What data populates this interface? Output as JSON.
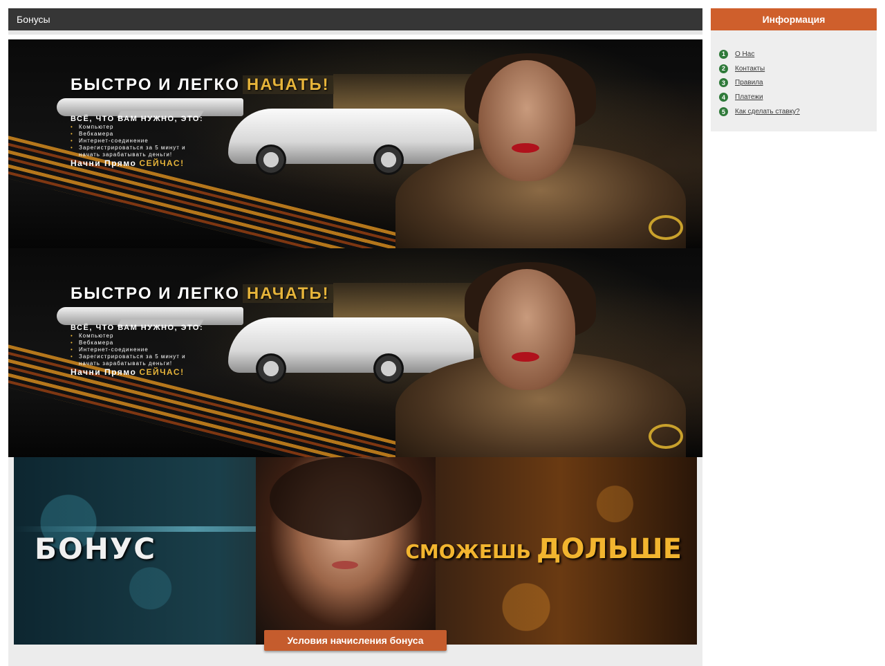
{
  "header": {
    "title": "Бонусы"
  },
  "promo_banners": [
    {
      "headline_main": "БЫСТРО И ЛЕГКО",
      "headline_accent": "НАЧАТЬ!",
      "subheading": "ВСЁ, ЧТО ВАМ НУЖНО, ЭТО:",
      "list": [
        "Компьютер",
        "Вебкамера",
        "Интернет-соединение",
        "Зарегистрироваться за 5 минут и",
        "начать зарабатывать деньги!"
      ],
      "cta_main": "Начни Прямо",
      "cta_accent": "СЕЙЧАС!"
    },
    {
      "headline_main": "БЫСТРО И ЛЕГКО",
      "headline_accent": "НАЧАТЬ!",
      "subheading": "ВСЁ, ЧТО ВАМ НУЖНО, ЭТО:",
      "list": [
        "Компьютер",
        "Вебкамера",
        "Интернет-соединение",
        "Зарегистрироваться за 5 минут и",
        "начать зарабатывать деньги!"
      ],
      "cta_main": "Начни Прямо",
      "cta_accent": "СЕЙЧАС!"
    }
  ],
  "bonus_banner": {
    "left_text": "БОНУС",
    "right_text_1": "СМОЖЕШЬ",
    "right_text_2": "ДОЛЬШЕ",
    "button_label": "Условия начисления бонуса"
  },
  "sidebar": {
    "title": "Информация",
    "items": [
      {
        "num": "1",
        "label": "О Нас"
      },
      {
        "num": "2",
        "label": "Контакты"
      },
      {
        "num": "3",
        "label": "Правила"
      },
      {
        "num": "4",
        "label": "Платежи"
      },
      {
        "num": "5",
        "label": "Как сделать ставку?"
      }
    ]
  },
  "colors": {
    "header_bg": "#363636",
    "sidebar_header_bg": "#cf5f2c",
    "button_bg": "#c55c2d",
    "number_badge": "#2f7a3a",
    "accent_gold": "#e6b43a"
  }
}
